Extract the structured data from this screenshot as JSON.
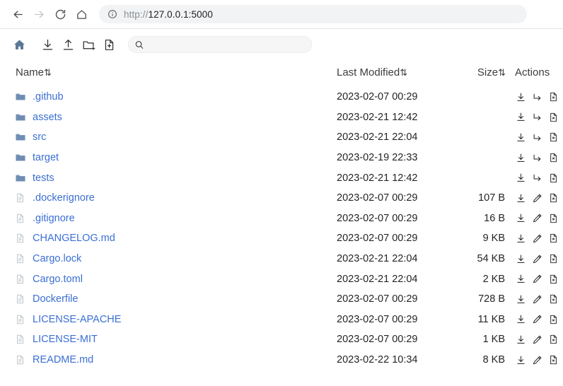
{
  "browser": {
    "nav": {
      "back_label": "Back",
      "forward_label": "Forward",
      "reload_label": "Reload",
      "home_label": "Home"
    },
    "address": {
      "scheme": "http://",
      "host": "127.0.0.1:5000",
      "full_url": "http://127.0.0.1:5000",
      "info_icon": "info-circle-icon"
    }
  },
  "toolbar": {
    "home_label": "Home",
    "download_label": "Download",
    "upload_label": "Upload",
    "new_folder_label": "New folder",
    "new_file_label": "New file",
    "search": {
      "value": "",
      "placeholder": ""
    }
  },
  "table": {
    "headers": {
      "name": "Name",
      "last_modified": "Last Modified",
      "size": "Size",
      "actions": "Actions",
      "sort_glyph": "⇅"
    },
    "rows": [
      {
        "type": "folder",
        "name": ".github",
        "modified": "2023-02-07 00:29",
        "size": "",
        "actions": [
          "download",
          "move",
          "delete"
        ]
      },
      {
        "type": "folder",
        "name": "assets",
        "modified": "2023-02-21 12:42",
        "size": "",
        "actions": [
          "download",
          "move",
          "delete"
        ]
      },
      {
        "type": "folder",
        "name": "src",
        "modified": "2023-02-21 22:04",
        "size": "",
        "actions": [
          "download",
          "move",
          "delete"
        ]
      },
      {
        "type": "folder",
        "name": "target",
        "modified": "2023-02-19 22:33",
        "size": "",
        "actions": [
          "download",
          "move",
          "delete"
        ]
      },
      {
        "type": "folder",
        "name": "tests",
        "modified": "2023-02-21 12:42",
        "size": "",
        "actions": [
          "download",
          "move",
          "delete"
        ]
      },
      {
        "type": "file",
        "name": ".dockerignore",
        "modified": "2023-02-07 00:29",
        "size": "107 B",
        "actions": [
          "download",
          "edit",
          "delete"
        ]
      },
      {
        "type": "file",
        "name": ".gitignore",
        "modified": "2023-02-07 00:29",
        "size": "16 B",
        "actions": [
          "download",
          "edit",
          "delete"
        ]
      },
      {
        "type": "file",
        "name": "CHANGELOG.md",
        "modified": "2023-02-07 00:29",
        "size": "9 KB",
        "actions": [
          "download",
          "edit",
          "delete"
        ]
      },
      {
        "type": "file",
        "name": "Cargo.lock",
        "modified": "2023-02-21 22:04",
        "size": "54 KB",
        "actions": [
          "download",
          "edit",
          "delete"
        ]
      },
      {
        "type": "file",
        "name": "Cargo.toml",
        "modified": "2023-02-21 22:04",
        "size": "2 KB",
        "actions": [
          "download",
          "edit",
          "delete"
        ]
      },
      {
        "type": "file",
        "name": "Dockerfile",
        "modified": "2023-02-07 00:29",
        "size": "728 B",
        "actions": [
          "download",
          "edit",
          "delete"
        ]
      },
      {
        "type": "file",
        "name": "LICENSE-APACHE",
        "modified": "2023-02-07 00:29",
        "size": "11 KB",
        "actions": [
          "download",
          "edit",
          "delete"
        ]
      },
      {
        "type": "file",
        "name": "LICENSE-MIT",
        "modified": "2023-02-07 00:29",
        "size": "1 KB",
        "actions": [
          "download",
          "edit",
          "delete"
        ]
      },
      {
        "type": "file",
        "name": "README.md",
        "modified": "2023-02-22 10:34",
        "size": "8 KB",
        "actions": [
          "download",
          "edit",
          "delete"
        ]
      }
    ]
  },
  "colors": {
    "link": "#3b6fd4",
    "folder_icon": "#6f8db3",
    "file_icon": "#c2c7cc",
    "home_icon": "#5b7897",
    "url_bar_bg": "#f1f3f4",
    "text": "#242424"
  }
}
